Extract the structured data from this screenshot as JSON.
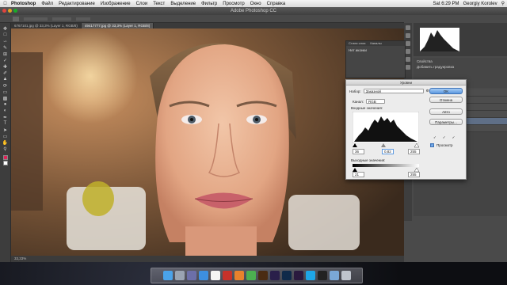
{
  "menubar": {
    "app": "Photoshop",
    "items": [
      "Файл",
      "Редактирование",
      "Изображение",
      "Слои",
      "Текст",
      "Выделение",
      "Фильтр",
      "Просмотр",
      "Окно",
      "Справка"
    ],
    "clock": "Sat 6:29 PM",
    "user": "Georgiy Korolev"
  },
  "window": {
    "title": "Adobe Photoshop CC"
  },
  "tabs": [
    {
      "label": "6767101.jpg @ 33,3% (Layer 1, RGB/8)",
      "active": false
    },
    {
      "label": "49417777.jpg @ 33,3% (Layer 1, RGB/8)",
      "active": true
    }
  ],
  "statusbar": {
    "zoom": "33,33%"
  },
  "float_panel": {
    "tabs": [
      "Стили слоя",
      "Каналы"
    ],
    "body": "Нет иконки"
  },
  "levels_dialog": {
    "title": "Уровни",
    "preset_label": "Набор:",
    "preset_value": "Заказной",
    "channel_label": "Канал:",
    "channel_value": "RGB",
    "input_label": "Входные значения:",
    "output_label": "Выходные значения:",
    "input_black": "36",
    "input_gamma": "0,82",
    "input_white": "255",
    "output_black": "21",
    "output_white": "255",
    "ok_label": "OK",
    "cancel_label": "Отмена",
    "auto_label": "Авто",
    "options_label": "Параметры...",
    "preview_label": "Просмотр",
    "preview_checked": true
  },
  "props_panel": {
    "title": "Свойства",
    "subtitle": "Добавить градуировка"
  },
  "colors": {
    "accent": "#5b98df",
    "foreground": "#e0225a",
    "background": "#ffffff"
  },
  "dock_icons": [
    "finder-icon",
    "launchpad-icon",
    "mission-control-icon",
    "safari-icon",
    "calendar-icon",
    "filezilla-icon",
    "firefox-icon",
    "chrome-icon",
    "illustrator-icon",
    "after-effects-icon",
    "photoshop-icon",
    "premiere-icon",
    "skype-icon",
    "terminal-icon",
    "folder-icon",
    "trash-icon"
  ]
}
